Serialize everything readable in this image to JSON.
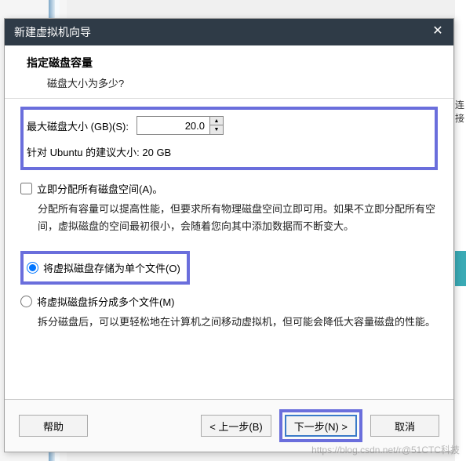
{
  "titlebar": {
    "title": "新建虚拟机向导"
  },
  "header": {
    "title": "指定磁盘容量",
    "subtitle": "磁盘大小为多少?"
  },
  "disk": {
    "size_label": "最大磁盘大小 (GB)(S):",
    "size_value": "20.0",
    "recommend": "针对 Ubuntu 的建议大小: 20 GB"
  },
  "allocate": {
    "checkbox_label": "立即分配所有磁盘空间(A)。",
    "desc": "分配所有容量可以提高性能，但要求所有物理磁盘空间立即可用。如果不立即分配所有空间，虚拟磁盘的空间最初很小，会随着您向其中添加数据而不断变大。"
  },
  "store": {
    "single_label": "将虚拟磁盘存储为单个文件(O)",
    "split_label": "将虚拟磁盘拆分成多个文件(M)",
    "split_desc": "拆分磁盘后，可以更轻松地在计算机之间移动虚拟机，但可能会降低大容量磁盘的性能。"
  },
  "footer": {
    "help": "帮助",
    "back": "< 上一步(B)",
    "next": "下一步(N) >",
    "cancel": "取消"
  },
  "bg": {
    "right_text": "连接"
  },
  "watermark": "https://blog.csdn.net/r@51CTC科技"
}
